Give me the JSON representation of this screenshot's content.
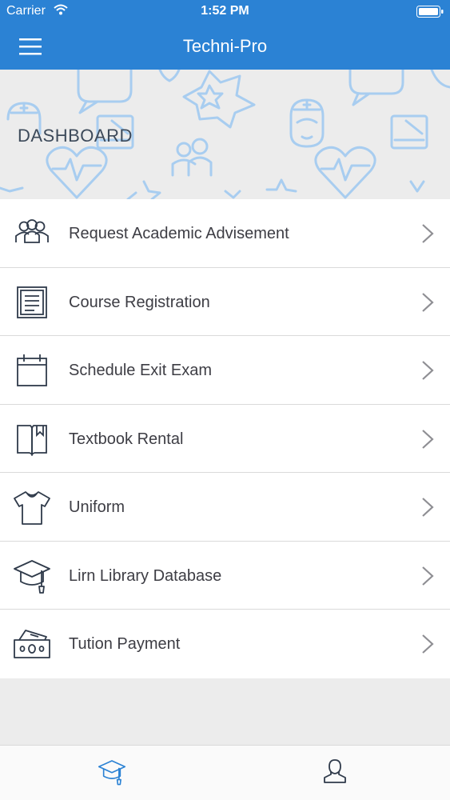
{
  "status_bar": {
    "carrier": "Carrier",
    "time": "1:52 PM",
    "wifi_icon": "wifi-icon",
    "battery_icon": "battery-icon"
  },
  "navbar": {
    "title": "Techni-Pro",
    "menu_icon": "hamburger-menu-icon"
  },
  "hero": {
    "heading": "DASHBOARD"
  },
  "menu": [
    {
      "label": "Request Academic Advisement",
      "icon": "people-group-icon"
    },
    {
      "label": "Course Registration",
      "icon": "document-list-icon"
    },
    {
      "label": "Schedule Exit Exam",
      "icon": "calendar-icon"
    },
    {
      "label": "Textbook Rental",
      "icon": "book-icon"
    },
    {
      "label": "Uniform",
      "icon": "shirt-icon"
    },
    {
      "label": "Lirn Library Database",
      "icon": "graduation-cap-icon"
    },
    {
      "label": "Tution Payment",
      "icon": "money-icon"
    }
  ],
  "tabbar": {
    "tabs": [
      {
        "icon": "graduation-cap-icon",
        "active": true
      },
      {
        "icon": "user-icon",
        "active": false
      }
    ]
  },
  "colors": {
    "primary": "#2b82d4",
    "hero_pattern": "#a8cdf0",
    "text": "#3d3d44",
    "chevron": "#8e8e93"
  }
}
